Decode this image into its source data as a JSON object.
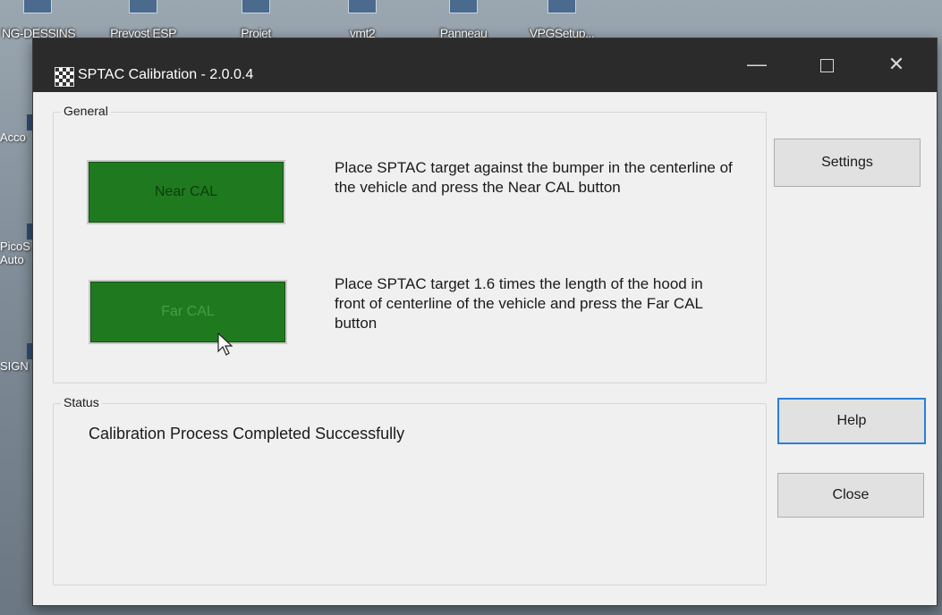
{
  "desktop": {
    "icons": [
      {
        "label": "NG-DESSINS"
      },
      {
        "label": "Prevost ESP"
      },
      {
        "label": "Projet"
      },
      {
        "label": "vmt2"
      },
      {
        "label": "Panneau"
      },
      {
        "label": "VPGSetup..."
      }
    ],
    "side_icons": [
      {
        "label": "Acco"
      },
      {
        "label": "PicoS"
      },
      {
        "label": "Auto"
      },
      {
        "label": "SIGN"
      }
    ]
  },
  "window": {
    "title": "SPTAC Calibration - 2.0.0.4",
    "controls": {
      "minimize": "—",
      "close": "✕"
    }
  },
  "general": {
    "legend": "General",
    "near_button": "Near CAL",
    "near_instruction": "Place SPTAC target against the bumper in the centerline of the vehicle and press the Near CAL button",
    "far_button": "Far CAL",
    "far_instruction": "Place SPTAC target 1.6 times the length of the hood in front of centerline of the vehicle and press the Far CAL button"
  },
  "status": {
    "legend": "Status",
    "message": "Calibration Process Completed Successfully"
  },
  "buttons": {
    "settings": "Settings",
    "help": "Help",
    "close": "Close"
  },
  "colors": {
    "cal_button": "#1f7a1f",
    "titlebar": "#2b2b2b",
    "focus_border": "#2a7fd4"
  }
}
